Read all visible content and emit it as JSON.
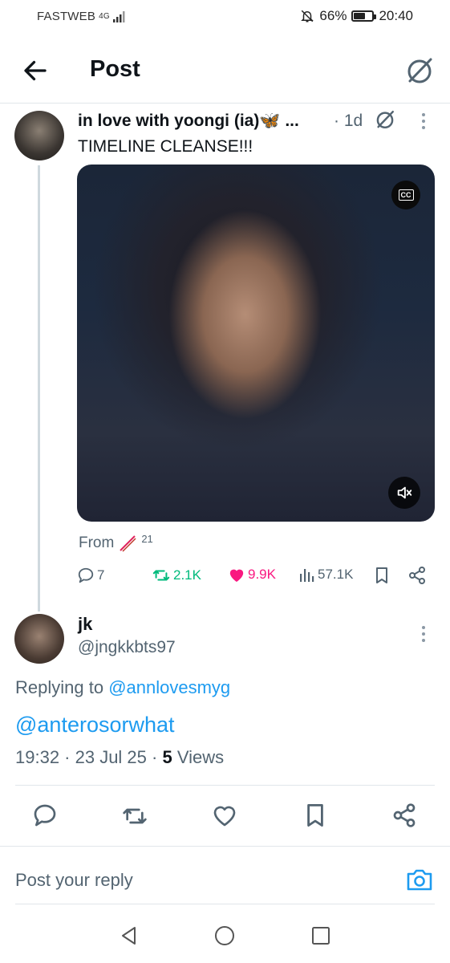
{
  "status_bar": {
    "carrier": "FASTWEB",
    "network": "4G",
    "battery_percent": 66,
    "battery_label": "66%",
    "time": "20:40"
  },
  "header": {
    "title": "Post"
  },
  "quoted_tweet": {
    "display_name": "in love with yoongi (ia)🦋 ...",
    "age": "· 1d",
    "text": "TIMELINE CLEANSE!!!",
    "cc_label": "CC",
    "from_label": "From",
    "from_count": "21",
    "retweets": "2.1K",
    "likes": "9.9K",
    "views": "57.1K",
    "replies": "7"
  },
  "reply": {
    "display_name": "jk",
    "handle": "@jngkkbts97",
    "replying_prefix": "Replying to",
    "replying_to": "@annlovesmyg",
    "mention": "@anterosorwhat",
    "timestamp": "19:32 · 23 Jul 25 ·",
    "views_count": "5",
    "views_label": "Views"
  },
  "reply_composer": {
    "placeholder": "Post your reply"
  },
  "colors": {
    "link": "#1d9bf0",
    "retweet": "#00ba7c",
    "like": "#f91880",
    "muted": "#536471"
  }
}
